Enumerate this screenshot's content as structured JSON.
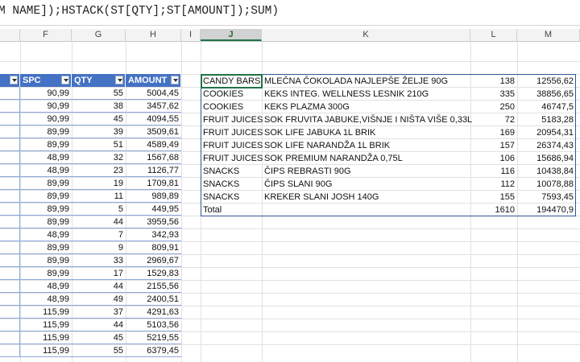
{
  "formula_bar": {
    "text": "M NAME]);HSTACK(ST[QTY];ST[AMOUNT]);SUM)"
  },
  "columns": [
    {
      "id": "F",
      "label": "F"
    },
    {
      "id": "G",
      "label": "G"
    },
    {
      "id": "H",
      "label": "H"
    },
    {
      "id": "I",
      "label": "I"
    },
    {
      "id": "J",
      "label": "J"
    },
    {
      "id": "K",
      "label": "K"
    },
    {
      "id": "L",
      "label": "L"
    },
    {
      "id": "M",
      "label": "M"
    }
  ],
  "source_table": {
    "headers": {
      "spc": "SPC",
      "qty": "QTY",
      "amount": "AMOUNT"
    },
    "rows": [
      [
        "90,99",
        "55",
        "5004,45"
      ],
      [
        "90,99",
        "38",
        "3457,62"
      ],
      [
        "90,99",
        "45",
        "4094,55"
      ],
      [
        "89,99",
        "39",
        "3509,61"
      ],
      [
        "89,99",
        "51",
        "4589,49"
      ],
      [
        "48,99",
        "32",
        "1567,68"
      ],
      [
        "48,99",
        "23",
        "1126,77"
      ],
      [
        "89,99",
        "19",
        "1709,81"
      ],
      [
        "89,99",
        "11",
        "989,89"
      ],
      [
        "89,99",
        "5",
        "449,95"
      ],
      [
        "89,99",
        "44",
        "3959,56"
      ],
      [
        "48,99",
        "7",
        "342,93"
      ],
      [
        "89,99",
        "9",
        "809,91"
      ],
      [
        "89,99",
        "33",
        "2969,67"
      ],
      [
        "89,99",
        "17",
        "1529,83"
      ],
      [
        "48,99",
        "44",
        "2155,56"
      ],
      [
        "48,99",
        "49",
        "2400,51"
      ],
      [
        "115,99",
        "37",
        "4291,63"
      ],
      [
        "115,99",
        "44",
        "5103,56"
      ],
      [
        "115,99",
        "45",
        "5219,55"
      ],
      [
        "115,99",
        "55",
        "6379,45"
      ]
    ]
  },
  "result_table": {
    "rows": [
      [
        "CANDY BARS",
        "MLEČNA ČOKOLADA NAJLEPŠE ŽELJE 90G",
        "138",
        "12556,62"
      ],
      [
        "COOKIES",
        "KEKS INTEG. WELLNESS LESNIK 210G",
        "335",
        "38856,65"
      ],
      [
        "COOKIES",
        "KEKS PLAZMA 300G",
        "250",
        "46747,5"
      ],
      [
        "FRUIT JUICES",
        "SOK FRUVITA JABUKE,VIŠNJE I NIŠTA VIŠE 0,33L",
        "72",
        "5183,28"
      ],
      [
        "FRUIT JUICES",
        "SOK LIFE JABUKA 1L BRIK",
        "169",
        "20954,31"
      ],
      [
        "FRUIT JUICES",
        "SOK LIFE NARANDŽA 1L BRIK",
        "157",
        "26374,43"
      ],
      [
        "FRUIT JUICES",
        "SOK PREMIUM NARANDŽA 0,75L",
        "106",
        "15686,94"
      ],
      [
        "SNACKS",
        "ČIPS REBRASTI 90G",
        "116",
        "10438,84"
      ],
      [
        "SNACKS",
        "ČIPS SLANI 90G",
        "112",
        "10078,88"
      ],
      [
        "SNACKS",
        "KREKER SLANI JOSH 140G",
        "155",
        "7593,45"
      ]
    ],
    "total": [
      "Total",
      "",
      "1610",
      "194470,9"
    ]
  }
}
